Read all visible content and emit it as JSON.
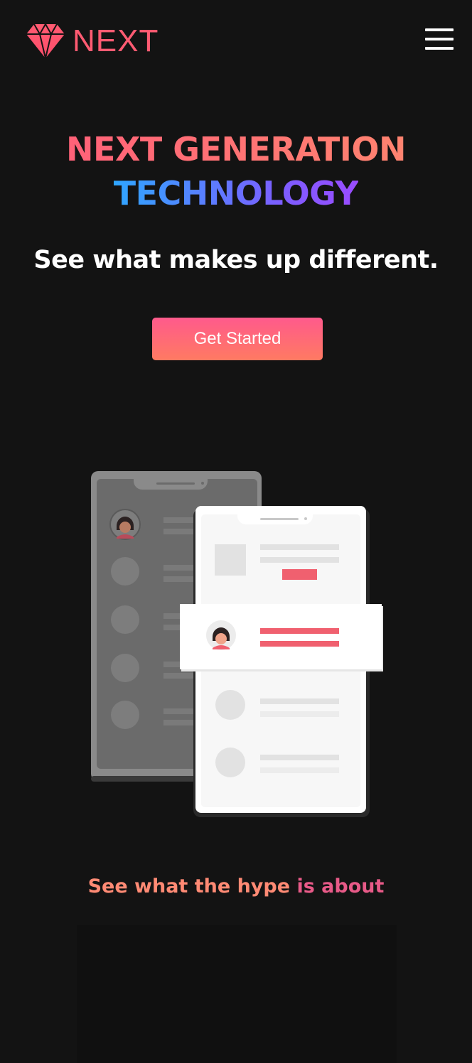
{
  "brand": {
    "logo_text": "NEXT",
    "logo_icon": "diamond-icon",
    "accent_color": "#ff5b72"
  },
  "nav": {
    "menu_icon": "hamburger-menu-icon"
  },
  "hero": {
    "headline_line1": "NEXT GENERATION",
    "headline_line2": "TECHNOLOGY",
    "subtitle": "See what makes up different.",
    "cta_label": "Get Started",
    "gradient_pink": "#ff5b7a",
    "gradient_blue": "#2fa6ff",
    "gradient_purple": "#9a4cff"
  },
  "section": {
    "hype_part1": "See what the hype",
    "hype_part2": "is about"
  }
}
